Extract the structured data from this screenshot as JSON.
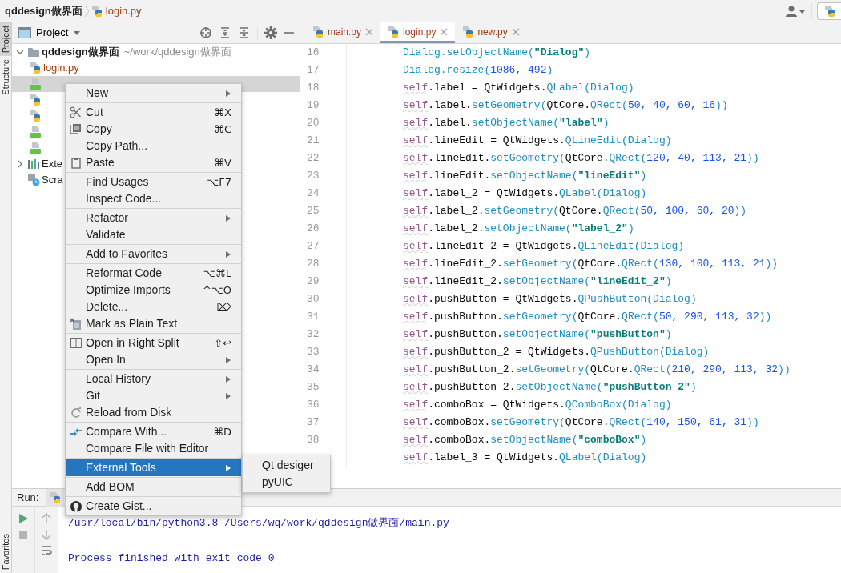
{
  "breadcrumb": [
    {
      "kind": "folder",
      "text": "qddesign做界面"
    },
    {
      "kind": "python",
      "text": "login.py"
    }
  ],
  "tool_strip": {
    "tools": [
      {
        "label": "Project",
        "selected": true
      },
      {
        "label": "Structure",
        "selected": false
      }
    ],
    "bottom_tool": "Favorites"
  },
  "project_panel": {
    "title": "Project",
    "tree": [
      {
        "kind": "folder",
        "name": "qddesign做界面",
        "path": "~/work/qddesign做界面",
        "expanded": true,
        "selected": false,
        "children": [
          {
            "kind": "python",
            "name": "login.py",
            "selected": false
          },
          {
            "kind": "qt",
            "selected": true
          },
          {
            "kind": "python",
            "selected": false
          },
          {
            "kind": "python",
            "selected": false
          },
          {
            "kind": "qt",
            "selected": false
          },
          {
            "kind": "qt",
            "selected": false
          }
        ]
      },
      {
        "kind": "library",
        "name": "Exte",
        "expanded": false,
        "selected": false
      },
      {
        "kind": "scratches",
        "name": "Scra",
        "selected": false
      }
    ]
  },
  "editor": {
    "tabs": [
      {
        "label": "main.py",
        "selected": false
      },
      {
        "label": "login.py",
        "selected": true
      },
      {
        "label": "new.py",
        "selected": false
      }
    ],
    "lines": [
      {
        "number": "16",
        "tokens": [
          {
            "kind": "call",
            "text": "Dialog.setObjectName("
          },
          {
            "kind": "string",
            "text": "\"Dialog\""
          },
          {
            "kind": "call",
            "text": ")"
          }
        ]
      },
      {
        "number": "17",
        "tokens": [
          {
            "kind": "call",
            "text": "Dialog.resize("
          },
          {
            "kind": "number",
            "text": "1086, 492"
          },
          {
            "kind": "call",
            "text": ")"
          }
        ]
      },
      {
        "number": "18",
        "tokens": [
          {
            "kind": "self",
            "text": "self"
          },
          {
            "kind": "plain",
            "text": ".label = QtWidgets."
          },
          {
            "kind": "call",
            "text": "QLabel(Dialog)"
          }
        ]
      },
      {
        "number": "19",
        "tokens": [
          {
            "kind": "self",
            "text": "self"
          },
          {
            "kind": "plain",
            "text": ".label."
          },
          {
            "kind": "call",
            "text": "setGeometry("
          },
          {
            "kind": "plain",
            "text": "QtCore."
          },
          {
            "kind": "call",
            "text": "QRect("
          },
          {
            "kind": "number",
            "text": "50, 40, 60, 16"
          },
          {
            "kind": "call",
            "text": "))"
          }
        ]
      },
      {
        "number": "20",
        "tokens": [
          {
            "kind": "self",
            "text": "self"
          },
          {
            "kind": "plain",
            "text": ".label."
          },
          {
            "kind": "call",
            "text": "setObjectName("
          },
          {
            "kind": "string",
            "text": "\"label\""
          },
          {
            "kind": "call",
            "text": ")"
          }
        ]
      },
      {
        "number": "21",
        "tokens": [
          {
            "kind": "self",
            "text": "self"
          },
          {
            "kind": "plain",
            "text": ".lineEdit = QtWidgets."
          },
          {
            "kind": "call",
            "text": "QLineEdit(Dialog)"
          }
        ]
      },
      {
        "number": "22",
        "tokens": [
          {
            "kind": "self",
            "text": "self"
          },
          {
            "kind": "plain",
            "text": ".lineEdit."
          },
          {
            "kind": "call",
            "text": "setGeometry("
          },
          {
            "kind": "plain",
            "text": "QtCore."
          },
          {
            "kind": "call",
            "text": "QRect("
          },
          {
            "kind": "number",
            "text": "120, 40, 113, 21"
          },
          {
            "kind": "call",
            "text": "))"
          }
        ]
      },
      {
        "number": "23",
        "tokens": [
          {
            "kind": "self",
            "text": "self"
          },
          {
            "kind": "plain",
            "text": ".lineEdit."
          },
          {
            "kind": "call",
            "text": "setObjectName("
          },
          {
            "kind": "string",
            "text": "\"lineEdit\""
          },
          {
            "kind": "call",
            "text": ")"
          }
        ]
      },
      {
        "number": "24",
        "tokens": [
          {
            "kind": "self",
            "text": "self"
          },
          {
            "kind": "plain",
            "text": ".label_2 = QtWidgets."
          },
          {
            "kind": "call",
            "text": "QLabel(Dialog)"
          }
        ]
      },
      {
        "number": "25",
        "tokens": [
          {
            "kind": "self",
            "text": "self"
          },
          {
            "kind": "plain",
            "text": ".label_2."
          },
          {
            "kind": "call",
            "text": "setGeometry("
          },
          {
            "kind": "plain",
            "text": "QtCore."
          },
          {
            "kind": "call",
            "text": "QRect("
          },
          {
            "kind": "number",
            "text": "50, 100, 60, 20"
          },
          {
            "kind": "call",
            "text": "))"
          }
        ]
      },
      {
        "number": "26",
        "tokens": [
          {
            "kind": "self",
            "text": "self"
          },
          {
            "kind": "plain",
            "text": ".label_2."
          },
          {
            "kind": "call",
            "text": "setObjectName("
          },
          {
            "kind": "string",
            "text": "\"label_2\""
          },
          {
            "kind": "call",
            "text": ")"
          }
        ]
      },
      {
        "number": "27",
        "tokens": [
          {
            "kind": "self",
            "text": "self"
          },
          {
            "kind": "plain",
            "text": ".lineEdit_2 = QtWidgets."
          },
          {
            "kind": "call",
            "text": "QLineEdit(Dialog)"
          }
        ]
      },
      {
        "number": "28",
        "tokens": [
          {
            "kind": "self",
            "text": "self"
          },
          {
            "kind": "plain",
            "text": ".lineEdit_2."
          },
          {
            "kind": "call",
            "text": "setGeometry("
          },
          {
            "kind": "plain",
            "text": "QtCore."
          },
          {
            "kind": "call",
            "text": "QRect("
          },
          {
            "kind": "number",
            "text": "130, 100, 113, 21"
          },
          {
            "kind": "call",
            "text": "))"
          }
        ]
      },
      {
        "number": "29",
        "tokens": [
          {
            "kind": "self",
            "text": "self"
          },
          {
            "kind": "plain",
            "text": ".lineEdit_2."
          },
          {
            "kind": "call",
            "text": "setObjectName("
          },
          {
            "kind": "string",
            "text": "\"lineEdit_2\""
          },
          {
            "kind": "call",
            "text": ")"
          }
        ]
      },
      {
        "number": "30",
        "tokens": [
          {
            "kind": "self",
            "text": "self"
          },
          {
            "kind": "plain",
            "text": ".pushButton = QtWidgets."
          },
          {
            "kind": "call",
            "text": "QPushButton(Dialog)"
          }
        ]
      },
      {
        "number": "31",
        "tokens": [
          {
            "kind": "self",
            "text": "self"
          },
          {
            "kind": "plain",
            "text": ".pushButton."
          },
          {
            "kind": "call",
            "text": "setGeometry("
          },
          {
            "kind": "plain",
            "text": "QtCore."
          },
          {
            "kind": "call",
            "text": "QRect("
          },
          {
            "kind": "number",
            "text": "50, 290, 113, 32"
          },
          {
            "kind": "call",
            "text": "))"
          }
        ]
      },
      {
        "number": "32",
        "tokens": [
          {
            "kind": "self",
            "text": "self"
          },
          {
            "kind": "plain",
            "text": ".pushButton."
          },
          {
            "kind": "call",
            "text": "setObjectName("
          },
          {
            "kind": "string",
            "text": "\"pushButton\""
          },
          {
            "kind": "call",
            "text": ")"
          }
        ]
      },
      {
        "number": "33",
        "tokens": [
          {
            "kind": "self",
            "text": "self"
          },
          {
            "kind": "plain",
            "text": ".pushButton_2 = QtWidgets."
          },
          {
            "kind": "call",
            "text": "QPushButton(Dialog)"
          }
        ]
      },
      {
        "number": "34",
        "tokens": [
          {
            "kind": "self",
            "text": "self"
          },
          {
            "kind": "plain",
            "text": ".pushButton_2."
          },
          {
            "kind": "call",
            "text": "setGeometry("
          },
          {
            "kind": "plain",
            "text": "QtCore."
          },
          {
            "kind": "call",
            "text": "QRect("
          },
          {
            "kind": "number",
            "text": "210, 290, 113, 32"
          },
          {
            "kind": "call",
            "text": "))"
          }
        ]
      },
      {
        "number": "35",
        "tokens": [
          {
            "kind": "self",
            "text": "self"
          },
          {
            "kind": "plain",
            "text": ".pushButton_2."
          },
          {
            "kind": "call",
            "text": "setObjectName("
          },
          {
            "kind": "string",
            "text": "\"pushButton_2\""
          },
          {
            "kind": "call",
            "text": ")"
          }
        ]
      },
      {
        "number": "36",
        "tokens": [
          {
            "kind": "self",
            "text": "self"
          },
          {
            "kind": "plain",
            "text": ".comboBox = QtWidgets."
          },
          {
            "kind": "call",
            "text": "QComboBox(Dialog)"
          }
        ]
      },
      {
        "number": "37",
        "tokens": [
          {
            "kind": "self",
            "text": "self"
          },
          {
            "kind": "plain",
            "text": ".comboBox."
          },
          {
            "kind": "call",
            "text": "setGeometry("
          },
          {
            "kind": "plain",
            "text": "QtCore."
          },
          {
            "kind": "call",
            "text": "QRect("
          },
          {
            "kind": "number",
            "text": "140, 150, 61, 31"
          },
          {
            "kind": "call",
            "text": "))"
          }
        ]
      },
      {
        "number": "38",
        "tokens": [
          {
            "kind": "self",
            "text": "self"
          },
          {
            "kind": "plain",
            "text": ".comboBox."
          },
          {
            "kind": "call",
            "text": "setObjectName("
          },
          {
            "kind": "string",
            "text": "\"comboBox\""
          },
          {
            "kind": "call",
            "text": ")"
          }
        ]
      },
      {
        "tokens": [
          {
            "kind": "self",
            "text": "self"
          },
          {
            "kind": "plain",
            "text": ".label_3 = QtWidgets."
          },
          {
            "kind": "call",
            "text": "QLabel(Dialog)"
          }
        ]
      }
    ]
  },
  "run_panel": {
    "title": "Run:",
    "output": [
      "/usr/local/bin/python3.8 /Users/wq/work/qddesign做界面/main.py",
      "Process finished with exit code 0"
    ]
  },
  "context_menu": {
    "items": [
      {
        "kind": "item",
        "label": "New",
        "submenu": true,
        "selected": false
      },
      {
        "kind": "separator"
      },
      {
        "kind": "cut",
        "label": "Cut",
        "shortcut": "⌘X",
        "submenu": false,
        "selected": false
      },
      {
        "kind": "copy",
        "label": "Copy",
        "shortcut": "⌘C",
        "submenu": false,
        "selected": false
      },
      {
        "kind": "item",
        "label": "Copy Path...",
        "submenu": false,
        "selected": false
      },
      {
        "kind": "paste",
        "label": "Paste",
        "shortcut": "⌘V",
        "submenu": false,
        "selected": false
      },
      {
        "kind": "separator"
      },
      {
        "kind": "item",
        "label": "Find Usages",
        "shortcut": "⌥F7",
        "submenu": false,
        "selected": false
      },
      {
        "kind": "item",
        "label": "Inspect Code...",
        "submenu": false,
        "selected": false
      },
      {
        "kind": "separator"
      },
      {
        "kind": "item",
        "label": "Refactor",
        "submenu": true,
        "selected": false
      },
      {
        "kind": "item",
        "label": "Validate",
        "submenu": false,
        "selected": false
      },
      {
        "kind": "separator"
      },
      {
        "kind": "item",
        "label": "Add to Favorites",
        "submenu": true,
        "selected": false
      },
      {
        "kind": "separator"
      },
      {
        "kind": "item",
        "label": "Reformat Code",
        "shortcut": "⌥⌘L",
        "submenu": false,
        "selected": false
      },
      {
        "kind": "item",
        "label": "Optimize Imports",
        "shortcut": "^⌥O",
        "submenu": false,
        "selected": false
      },
      {
        "kind": "item",
        "label": "Delete...",
        "shortcut": "⌦",
        "submenu": false,
        "selected": false
      },
      {
        "kind": "mark",
        "label": "Mark as Plain Text",
        "submenu": false,
        "selected": false
      },
      {
        "kind": "separator"
      },
      {
        "kind": "split",
        "label": "Open in Right Split",
        "shortcut": "⇧↩",
        "submenu": false,
        "selected": false
      },
      {
        "kind": "item",
        "label": "Open In",
        "submenu": true,
        "selected": false
      },
      {
        "kind": "separator"
      },
      {
        "kind": "item",
        "label": "Local History",
        "submenu": true,
        "selected": false
      },
      {
        "kind": "item",
        "label": "Git",
        "submenu": true,
        "selected": false
      },
      {
        "kind": "reload",
        "label": "Reload from Disk",
        "submenu": false,
        "selected": false
      },
      {
        "kind": "separator"
      },
      {
        "kind": "compare",
        "label": "Compare With...",
        "shortcut": "⌘D",
        "submenu": false,
        "selected": false
      },
      {
        "kind": "item",
        "label": "Compare File with Editor",
        "submenu": false,
        "selected": false
      },
      {
        "kind": "separator"
      },
      {
        "kind": "item",
        "label": "External Tools",
        "submenu": true,
        "selected": true
      },
      {
        "kind": "separator"
      },
      {
        "kind": "item",
        "label": "Add BOM",
        "submenu": false,
        "selected": false
      },
      {
        "kind": "separator"
      },
      {
        "kind": "gist",
        "label": "Create Gist...",
        "submenu": false,
        "selected": false
      }
    ]
  },
  "submenu": {
    "items": [
      {
        "label": "Qt desiger"
      },
      {
        "label": "pyUIC"
      }
    ]
  }
}
